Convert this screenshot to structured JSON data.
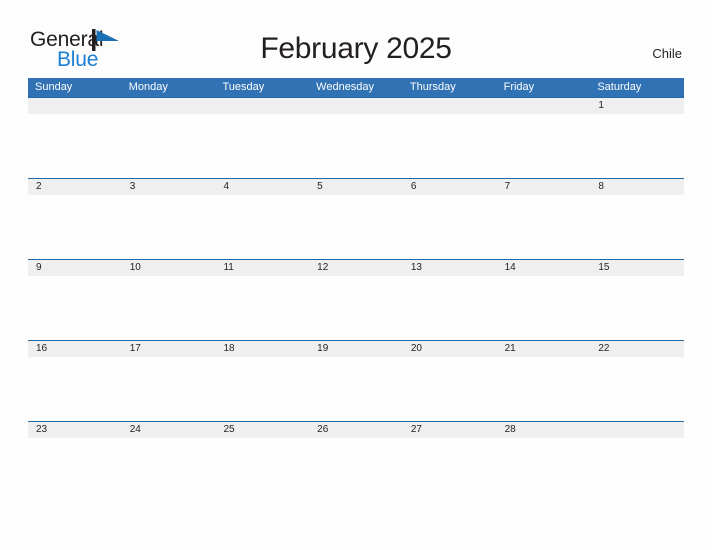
{
  "brand": {
    "name_part1": "General",
    "name_part2": "Blue",
    "flag_icon": "blue-flag-triangle",
    "color_dark": "#231F20",
    "color_blue": "#1B7FD4"
  },
  "header": {
    "title": "February 2025",
    "country": "Chile"
  },
  "theme": {
    "header_blue": "#3072B4",
    "divider_blue": "#1F6BA8",
    "date_strip_gray": "#EFEFEF",
    "cell_background": "#FDFDFE",
    "text_dark": "#231F20",
    "header_text": "#FFFFFF"
  },
  "calendar": {
    "month": "February",
    "year": "2025",
    "weekday_headers": [
      "Sunday",
      "Monday",
      "Tuesday",
      "Wednesday",
      "Thursday",
      "Friday",
      "Saturday"
    ],
    "weeks": [
      {
        "days": [
          "",
          "",
          "",
          "",
          "",
          "",
          "1"
        ]
      },
      {
        "days": [
          "2",
          "3",
          "4",
          "5",
          "6",
          "7",
          "8"
        ]
      },
      {
        "days": [
          "9",
          "10",
          "11",
          "12",
          "13",
          "14",
          "15"
        ]
      },
      {
        "days": [
          "16",
          "17",
          "18",
          "19",
          "20",
          "21",
          "22"
        ]
      },
      {
        "days": [
          "23",
          "24",
          "25",
          "26",
          "27",
          "28",
          ""
        ]
      }
    ]
  }
}
